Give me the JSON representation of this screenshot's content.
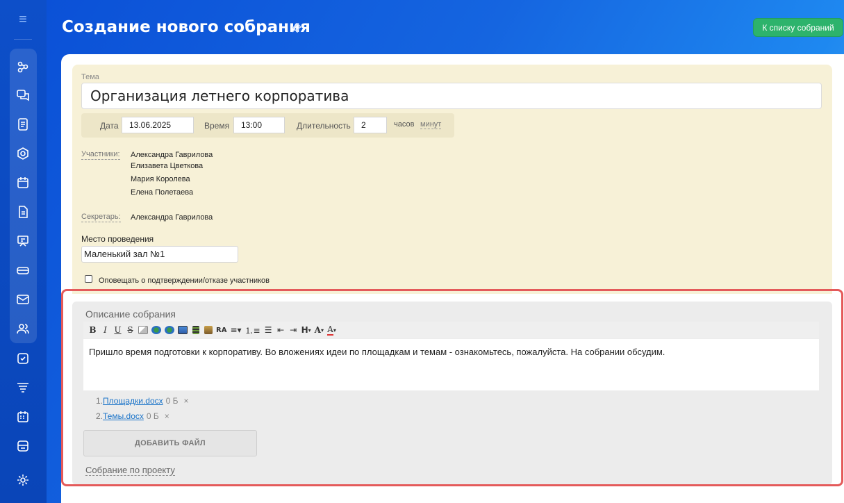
{
  "header": {
    "title": "Создание нового собрания",
    "list_button": "К списку собраний"
  },
  "form": {
    "topic_label": "Тема",
    "topic_value": "Организация летнего корпоратива",
    "date_label": "Дата",
    "date_value": "13.06.2025",
    "time_label": "Время",
    "time_value": "13:00",
    "duration_label": "Длительность",
    "duration_value": "2",
    "hours_label": "часов",
    "minutes_label": "минут",
    "participants_label": "Участники:",
    "participants": [
      "Александра Гаврилова",
      "Елизавета Цветкова",
      "Мария Королева",
      "Елена Полетаева"
    ],
    "secretary_label": "Секретарь:",
    "secretary_name": "Александра Гаврилова",
    "place_label": "Место проведения",
    "place_value": "Маленький зал №1",
    "notify_label": "Оповещать о подтверждении/отказе участников",
    "notify_checked": false
  },
  "description": {
    "title": "Описание собрания",
    "toolbar": {
      "bold": "B",
      "italic": "I",
      "underline": "U",
      "strike": "S",
      "heading": "H",
      "font_size": "A",
      "font_color": "A"
    },
    "text": "Пришло время подготовки к корпоративу. Во вложениях идеи по площадкам и темам - ознакомьтесь, пожалуйста. На собрании обсудим.",
    "files": [
      {
        "num": "1.",
        "name": "Площадки.docx",
        "size": "0 Б",
        "remove": "×"
      },
      {
        "num": "2.",
        "name": "Темы.docx",
        "size": "0 Б",
        "remove": "×"
      }
    ],
    "add_file_button": "ДОБАВИТЬ ФАЙЛ",
    "project_link": "Собрание по проекту"
  },
  "colors": {
    "accent_green": "#2db36c",
    "highlight_red": "#e45a5a",
    "form_bg": "#f7f1d7"
  }
}
